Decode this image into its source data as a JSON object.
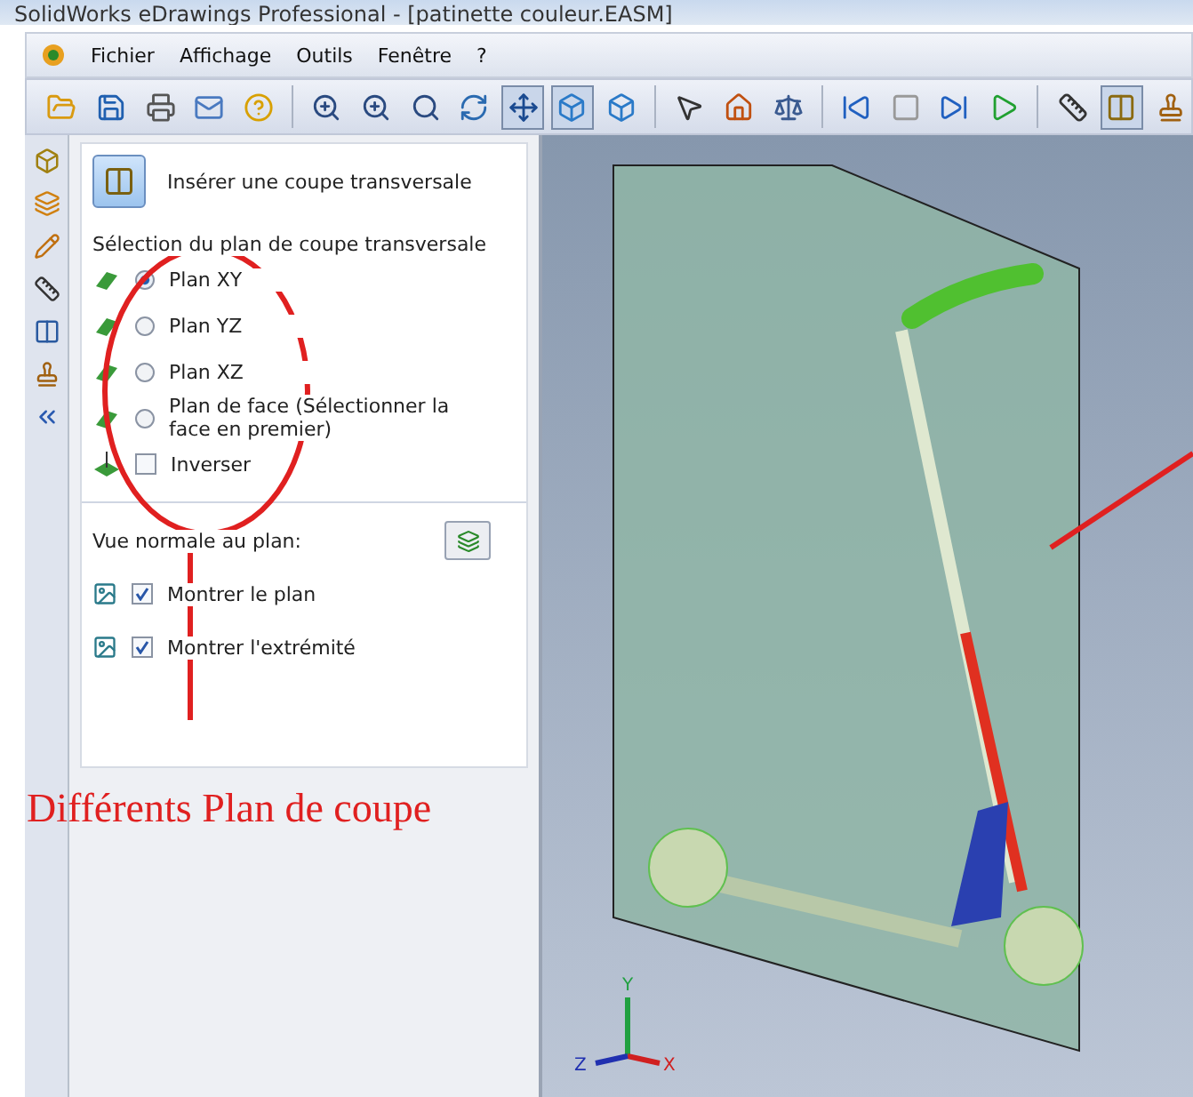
{
  "window": {
    "title": "SolidWorks eDrawings Professional - [patinette couleur.EASM]"
  },
  "menu": [
    "Fichier",
    "Affichage",
    "Outils",
    "Fenêtre",
    "?"
  ],
  "panel": {
    "title": "Insérer une coupe transversale",
    "group_label": "Sélection du plan de coupe transversale",
    "planes": [
      {
        "label": "Plan XY",
        "selected": true
      },
      {
        "label": "Plan YZ",
        "selected": false
      },
      {
        "label": "Plan XZ",
        "selected": false
      },
      {
        "label": "Plan de face (Sélectionner la face en premier)",
        "selected": false
      }
    ],
    "invert": {
      "label": "Inverser",
      "checked": false
    },
    "normal_view_label": "Vue normale au plan:",
    "options": [
      {
        "label": "Montrer le plan",
        "checked": true
      },
      {
        "label": "Montrer l'extrémité",
        "checked": true
      }
    ]
  },
  "annotation": "Différents Plan de coupe",
  "triad": {
    "axes": [
      "Y",
      "Z",
      "X"
    ]
  }
}
